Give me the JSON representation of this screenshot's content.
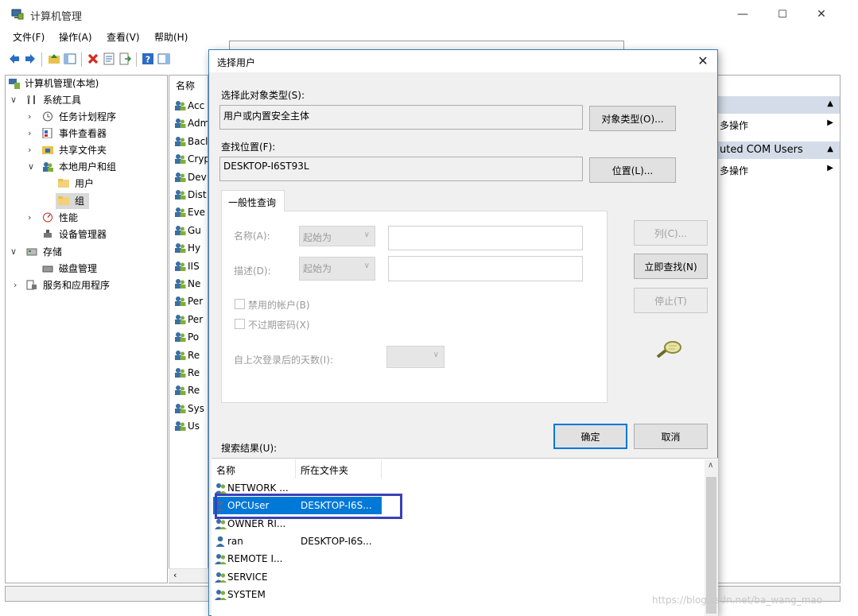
{
  "window": {
    "title": "计算机管理",
    "minimize": "—",
    "maximize": "☐",
    "close": "✕"
  },
  "menu": [
    "文件(F)",
    "操作(A)",
    "查看(V)",
    "帮助(H)"
  ],
  "tree": {
    "root": "计算机管理(本地)",
    "system_tools": "系统工具",
    "task_scheduler": "任务计划程序",
    "event_viewer": "事件查看器",
    "shared_folders": "共享文件夹",
    "local_users_groups": "本地用户和组",
    "users": "用户",
    "groups": "组",
    "performance": "性能",
    "device_manager": "设备管理器",
    "storage": "存储",
    "disk_management": "磁盘管理",
    "services_apps": "服务和应用程序"
  },
  "middle": {
    "header": "名称",
    "items": [
      "Acc",
      "Adm",
      "Bacl",
      "Cryp",
      "Dev",
      "Dist",
      "Eve",
      "Gu",
      "Hy",
      "IIS",
      "Ne",
      "Per",
      "Per",
      "Po",
      "Re",
      "Re",
      "Re",
      "Sys",
      "Us"
    ]
  },
  "actions": {
    "more_1": "多操作",
    "group_header": "uted COM Users",
    "more_2": "多操作"
  },
  "dialog": {
    "title": "选择用户",
    "close": "✕",
    "object_type_label": "选择此对象类型(S):",
    "object_type_value": "用户或内置安全主体",
    "object_type_button": "对象类型(O)...",
    "location_label": "查找位置(F):",
    "location_value": "DESKTOP-I6ST93L",
    "location_button": "位置(L)...",
    "tab_label": "一般性查询",
    "name_label": "名称(A):",
    "name_combo": "起始为",
    "desc_label": "描述(D):",
    "desc_combo": "起始为",
    "disabled_accounts": "禁用的帐户(B)",
    "non_expiring": "不过期密码(X)",
    "days_label": "自上次登录后的天数(I):",
    "columns_button": "列(C)...",
    "find_now_button": "立即查找(N)",
    "stop_button": "停止(T)",
    "ok_button": "确定",
    "cancel_button": "取消",
    "results_label": "搜索结果(U):",
    "results_headers": [
      "名称",
      "所在文件夹"
    ],
    "results": [
      {
        "name": "NETWORK ...",
        "folder": "",
        "type": "group"
      },
      {
        "name": "OPCUser",
        "folder": "DESKTOP-I6S...",
        "type": "user",
        "selected": true
      },
      {
        "name": "OWNER RI...",
        "folder": "",
        "type": "group"
      },
      {
        "name": "ran",
        "folder": "DESKTOP-I6S...",
        "type": "user"
      },
      {
        "name": "REMOTE I...",
        "folder": "",
        "type": "group"
      },
      {
        "name": "SERVICE",
        "folder": "",
        "type": "group"
      },
      {
        "name": "SYSTEM",
        "folder": "",
        "type": "group"
      }
    ]
  },
  "watermark": "https://blog.csdn.net/ba_wang_mao",
  "colors": {
    "accent": "#0078d7",
    "highlight_box": "#3a40b8",
    "action_header": "#d3dce8"
  }
}
